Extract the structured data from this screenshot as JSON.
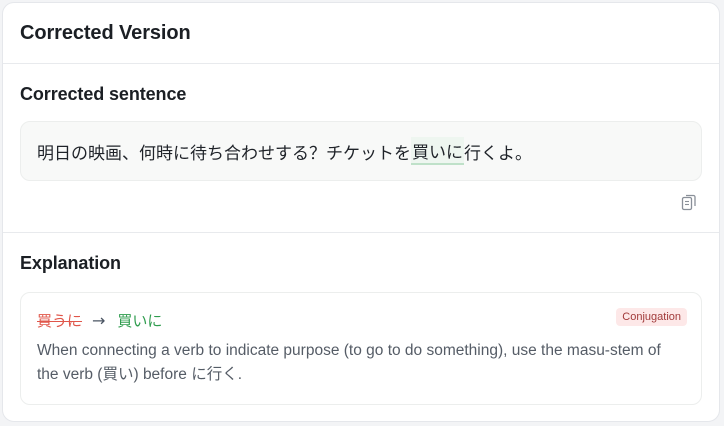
{
  "header": {
    "title": "Corrected Version"
  },
  "corrected": {
    "section_title": "Corrected sentence",
    "sentence_before": "明日の映画、何時に待ち合わせする？チケットを",
    "sentence_highlight": "買いに",
    "sentence_after": "行くよ。",
    "copy_icon": "copy-icon"
  },
  "explanation": {
    "section_title": "Explanation",
    "items": [
      {
        "original": "買うに",
        "arrow": "→",
        "corrected": "買いに",
        "badge": "Conjugation",
        "text": "When connecting a verb to indicate purpose (to go to do something), use the masu-stem of the verb (買い) before に行く."
      }
    ]
  },
  "colors": {
    "highlight_bg": "#eef6f0",
    "highlight_underline": "#bfe1c9",
    "original_red": "#e0564a",
    "corrected_green": "#2f9c4e",
    "badge_bg": "#fde8e8",
    "badge_text": "#a23b3b"
  }
}
